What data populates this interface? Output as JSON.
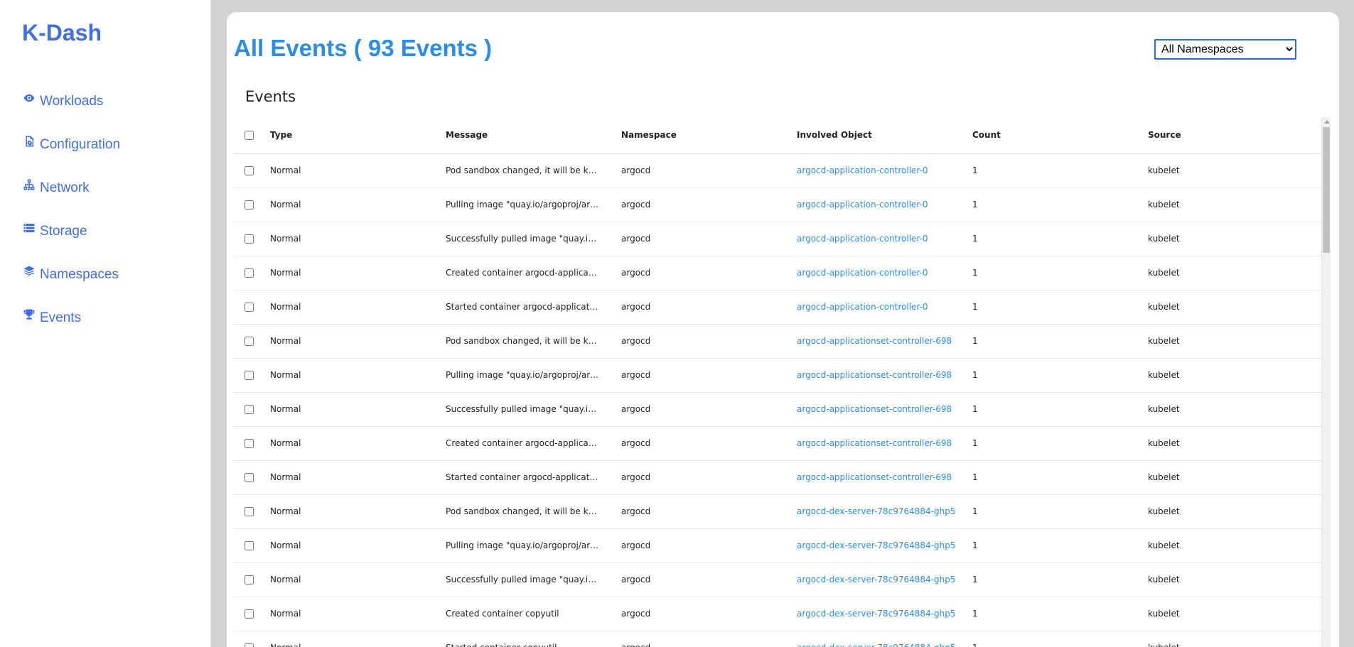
{
  "app": {
    "brand": "K-Dash"
  },
  "sidebar": {
    "items": [
      {
        "label": "Workloads",
        "icon": "eye-icon"
      },
      {
        "label": "Configuration",
        "icon": "file-gear-icon"
      },
      {
        "label": "Network",
        "icon": "network-icon"
      },
      {
        "label": "Storage",
        "icon": "storage-list-icon"
      },
      {
        "label": "Namespaces",
        "icon": "layers-icon"
      },
      {
        "label": "Events",
        "icon": "trophy-icon"
      }
    ]
  },
  "main": {
    "title": "All Events ( 93 Events )",
    "namespace_select": {
      "selected": "All Namespaces"
    },
    "section_title": "Events",
    "table": {
      "headers": {
        "type": "Type",
        "message": "Message",
        "namespace": "Namespace",
        "object": "Involved Object",
        "count": "Count",
        "source": "Source"
      },
      "rows": [
        {
          "type": "Normal",
          "message": "Pod sandbox changed, it will be killed and re-created.",
          "namespace": "argocd",
          "object": "argocd-application-controller-0",
          "count": "1",
          "source": "kubelet"
        },
        {
          "type": "Normal",
          "message": "Pulling image \"quay.io/argoproj/argocd\"",
          "namespace": "argocd",
          "object": "argocd-application-controller-0",
          "count": "1",
          "source": "kubelet"
        },
        {
          "type": "Normal",
          "message": "Successfully pulled image \"quay.io/argoproj/argocd\"",
          "namespace": "argocd",
          "object": "argocd-application-controller-0",
          "count": "1",
          "source": "kubelet"
        },
        {
          "type": "Normal",
          "message": "Created container argocd-application-controller",
          "namespace": "argocd",
          "object": "argocd-application-controller-0",
          "count": "1",
          "source": "kubelet"
        },
        {
          "type": "Normal",
          "message": "Started container argocd-application-controller",
          "namespace": "argocd",
          "object": "argocd-application-controller-0",
          "count": "1",
          "source": "kubelet"
        },
        {
          "type": "Normal",
          "message": "Pod sandbox changed, it will be killed and re-created.",
          "namespace": "argocd",
          "object": "argocd-applicationset-controller-698",
          "count": "1",
          "source": "kubelet"
        },
        {
          "type": "Normal",
          "message": "Pulling image \"quay.io/argoproj/argocd\"",
          "namespace": "argocd",
          "object": "argocd-applicationset-controller-698",
          "count": "1",
          "source": "kubelet"
        },
        {
          "type": "Normal",
          "message": "Successfully pulled image \"quay.io/argoproj/argocd\"",
          "namespace": "argocd",
          "object": "argocd-applicationset-controller-698",
          "count": "1",
          "source": "kubelet"
        },
        {
          "type": "Normal",
          "message": "Created container argocd-applicationset-controller",
          "namespace": "argocd",
          "object": "argocd-applicationset-controller-698",
          "count": "1",
          "source": "kubelet"
        },
        {
          "type": "Normal",
          "message": "Started container argocd-applicationset-controller",
          "namespace": "argocd",
          "object": "argocd-applicationset-controller-698",
          "count": "1",
          "source": "kubelet"
        },
        {
          "type": "Normal",
          "message": "Pod sandbox changed, it will be killed and re-created.",
          "namespace": "argocd",
          "object": "argocd-dex-server-78c9764884-ghp5",
          "count": "1",
          "source": "kubelet"
        },
        {
          "type": "Normal",
          "message": "Pulling image \"quay.io/argoproj/argocd\"",
          "namespace": "argocd",
          "object": "argocd-dex-server-78c9764884-ghp5",
          "count": "1",
          "source": "kubelet"
        },
        {
          "type": "Normal",
          "message": "Successfully pulled image \"quay.io/argoproj/argocd\"",
          "namespace": "argocd",
          "object": "argocd-dex-server-78c9764884-ghp5",
          "count": "1",
          "source": "kubelet"
        },
        {
          "type": "Normal",
          "message": "Created container copyutil",
          "namespace": "argocd",
          "object": "argocd-dex-server-78c9764884-ghp5",
          "count": "1",
          "source": "kubelet"
        },
        {
          "type": "Normal",
          "message": "Started container copyutil",
          "namespace": "argocd",
          "object": "argocd-dex-server-78c9764884-ghp5",
          "count": "1",
          "source": "kubelet"
        }
      ]
    }
  },
  "colors": {
    "brand": "#3f6ee5",
    "title": "#2a8ee8",
    "link": "#2a8ee8",
    "background": "#d3d3d3"
  }
}
